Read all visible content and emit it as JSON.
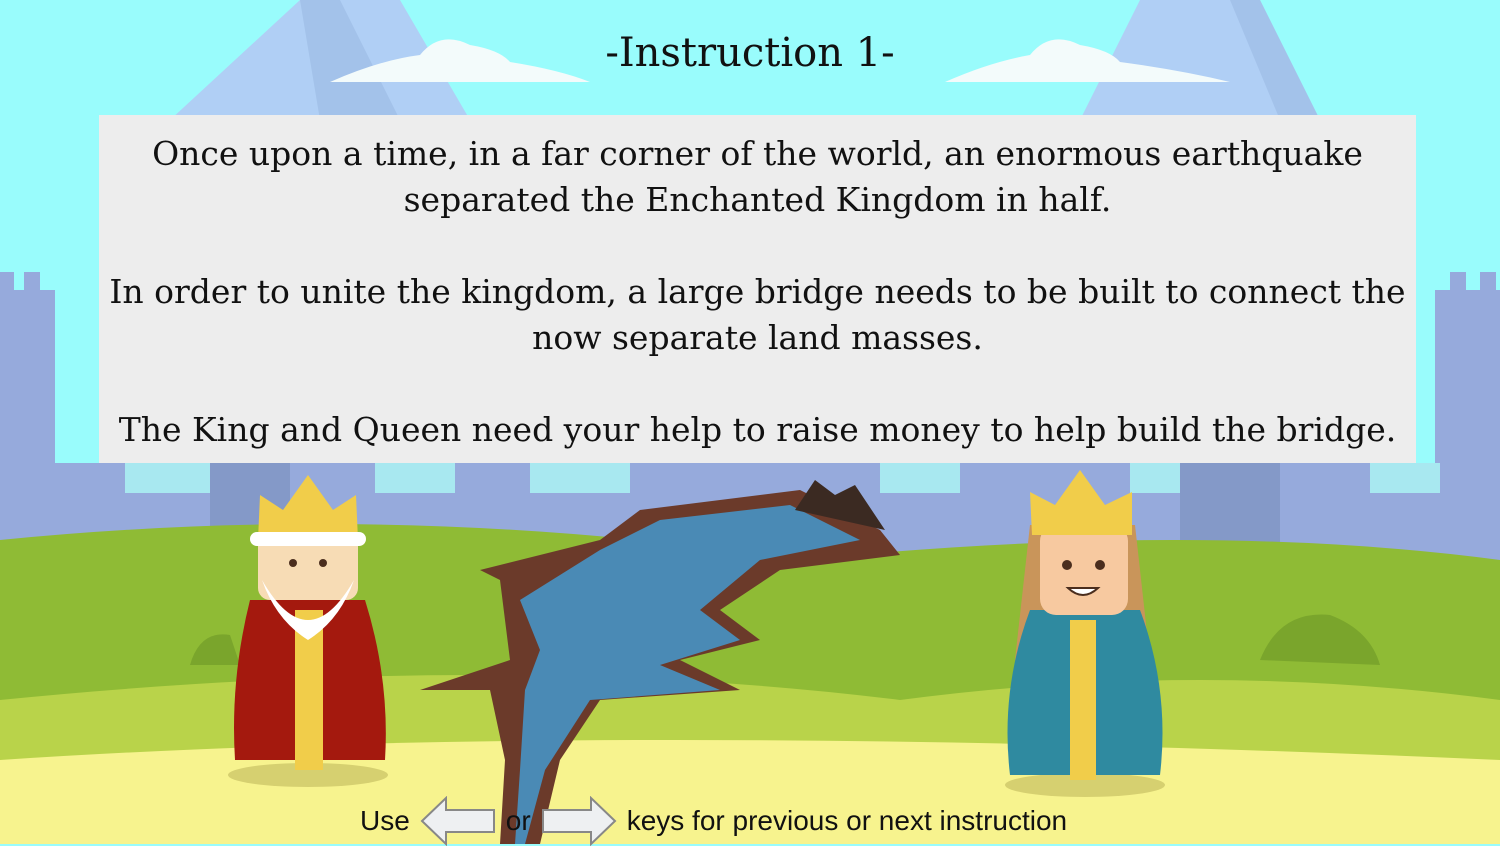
{
  "title": "-Instruction 1-",
  "story": {
    "paragraph_1_line_1": "Once upon a time, in a far corner of the world, an enormous earthquake",
    "paragraph_1_line_2": "separated the Enchanted Kingdom in half.",
    "paragraph_2_line_1": "In order to unite the kingdom, a large bridge needs to be built to connect the",
    "paragraph_2_line_2": "now separate land masses.",
    "paragraph_3": "The King and Queen need your help to raise money to help build the bridge."
  },
  "hint": {
    "use": "Use",
    "or": "or",
    "rest": "keys for previous or next instruction",
    "left_icon": "left-arrow-key-icon",
    "right_icon": "right-arrow-key-icon"
  },
  "colors": {
    "sky": "#99fcfc",
    "panel": "#ededed",
    "grass": "#8fbb35",
    "sand": "#f7f38e",
    "river": "#4a8ab5"
  }
}
